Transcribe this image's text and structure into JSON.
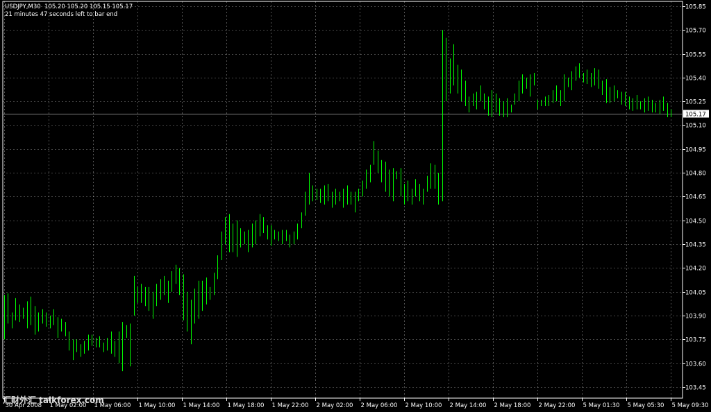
{
  "header": {
    "symbol_line": "USDJPY,M30  105.20 105.20 105.15 105.17",
    "countdown": "21 minutes 47 seconds left to bar end"
  },
  "watermark": "汇财外汇 talkforex.com",
  "chart_data": {
    "type": "ohlc",
    "symbol": "USDJPY",
    "timeframe": "M30",
    "current_price": 105.17,
    "current_price_label": "105.17",
    "ylim": [
      103.38,
      105.88
    ],
    "yticks": [
      105.85,
      105.7,
      105.55,
      105.4,
      105.25,
      105.1,
      104.95,
      104.8,
      104.65,
      104.5,
      104.35,
      104.2,
      104.05,
      103.9,
      103.75,
      103.6,
      103.45
    ],
    "ytick_labels": [
      "105.85",
      "105.70",
      "105.55",
      "105.40",
      "105.25",
      "105.10",
      "104.95",
      "104.80",
      "104.65",
      "104.50",
      "104.35",
      "104.20",
      "104.05",
      "103.90",
      "103.75",
      "103.60",
      "103.45"
    ],
    "xtick_labels": [
      "30 Apr 2008",
      "1 May 02:00",
      "1 May 06:00",
      "1 May 10:00",
      "1 May 14:00",
      "1 May 18:00",
      "1 May 22:00",
      "2 May 02:00",
      "2 May 06:00",
      "2 May 10:00",
      "2 May 14:00",
      "2 May 18:00",
      "2 May 22:00",
      "5 May 01:30",
      "5 May 05:30",
      "5 May 09:30"
    ],
    "grid": true,
    "bar_color": "#00ff00",
    "background": "#000000",
    "grid_color": "#ffffff",
    "bars": [
      [
        103.75,
        104.03
      ],
      [
        103.85,
        104.04
      ],
      [
        103.82,
        103.92
      ],
      [
        103.87,
        104.01
      ],
      [
        103.86,
        103.97
      ],
      [
        103.88,
        103.95
      ],
      [
        103.82,
        103.99
      ],
      [
        103.84,
        104.02
      ],
      [
        103.78,
        103.96
      ],
      [
        103.8,
        103.92
      ],
      [
        103.85,
        103.94
      ],
      [
        103.83,
        103.92
      ],
      [
        103.82,
        103.9
      ],
      [
        103.84,
        103.94
      ],
      [
        103.76,
        103.89
      ],
      [
        103.8,
        103.88
      ],
      [
        103.77,
        103.86
      ],
      [
        103.68,
        103.8
      ],
      [
        103.62,
        103.75
      ],
      [
        103.67,
        103.75
      ],
      [
        103.64,
        103.72
      ],
      [
        103.66,
        103.74
      ],
      [
        103.68,
        103.78
      ],
      [
        103.71,
        103.78
      ],
      [
        103.7,
        103.76
      ],
      [
        103.7,
        103.77
      ],
      [
        103.67,
        103.73
      ],
      [
        103.68,
        103.76
      ],
      [
        103.66,
        103.8
      ],
      [
        103.64,
        103.74
      ],
      [
        103.6,
        103.8
      ],
      [
        103.55,
        103.86
      ],
      [
        103.76,
        103.84
      ],
      [
        103.58,
        103.85
      ],
      [
        103.9,
        104.15
      ],
      [
        103.98,
        104.08
      ],
      [
        103.98,
        104.1
      ],
      [
        103.96,
        104.08
      ],
      [
        103.93,
        104.08
      ],
      [
        103.88,
        104.05
      ],
      [
        103.96,
        104.1
      ],
      [
        104.0,
        104.13
      ],
      [
        104.03,
        104.15
      ],
      [
        103.98,
        104.12
      ],
      [
        104.05,
        104.18
      ],
      [
        104.1,
        104.22
      ],
      [
        104.03,
        104.2
      ],
      [
        103.87,
        104.16
      ],
      [
        103.8,
        104.05
      ],
      [
        103.72,
        104.0
      ],
      [
        103.85,
        104.07
      ],
      [
        103.88,
        104.12
      ],
      [
        103.93,
        104.12
      ],
      [
        103.97,
        104.14
      ],
      [
        104.0,
        104.08
      ],
      [
        104.03,
        104.17
      ],
      [
        104.13,
        104.28
      ],
      [
        104.25,
        104.43
      ],
      [
        104.35,
        104.52
      ],
      [
        104.3,
        104.54
      ],
      [
        104.3,
        104.48
      ],
      [
        104.27,
        104.5
      ],
      [
        104.33,
        104.45
      ],
      [
        104.35,
        104.43
      ],
      [
        104.3,
        104.44
      ],
      [
        104.33,
        104.48
      ],
      [
        104.35,
        104.5
      ],
      [
        104.4,
        104.54
      ],
      [
        104.42,
        104.52
      ],
      [
        104.38,
        104.47
      ],
      [
        104.34,
        104.47
      ],
      [
        104.38,
        104.44
      ],
      [
        104.37,
        104.43
      ],
      [
        104.35,
        104.44
      ],
      [
        104.37,
        104.44
      ],
      [
        104.33,
        104.41
      ],
      [
        104.35,
        104.43
      ],
      [
        104.38,
        104.48
      ],
      [
        104.45,
        104.55
      ],
      [
        104.53,
        104.68
      ],
      [
        104.6,
        104.8
      ],
      [
        104.62,
        104.72
      ],
      [
        104.63,
        104.7
      ],
      [
        104.61,
        104.7
      ],
      [
        104.6,
        104.72
      ],
      [
        104.62,
        104.73
      ],
      [
        104.58,
        104.68
      ],
      [
        104.6,
        104.7
      ],
      [
        104.62,
        104.68
      ],
      [
        104.58,
        104.7
      ],
      [
        104.6,
        104.72
      ],
      [
        104.6,
        104.68
      ],
      [
        104.55,
        104.68
      ],
      [
        104.62,
        104.7
      ],
      [
        104.65,
        104.75
      ],
      [
        104.7,
        104.82
      ],
      [
        104.74,
        104.85
      ],
      [
        104.85,
        105.0
      ],
      [
        104.8,
        104.94
      ],
      [
        104.74,
        104.88
      ],
      [
        104.68,
        104.87
      ],
      [
        104.65,
        104.82
      ],
      [
        104.62,
        104.83
      ],
      [
        104.76,
        104.81
      ],
      [
        104.65,
        104.83
      ],
      [
        104.6,
        104.73
      ],
      [
        104.62,
        104.75
      ],
      [
        104.6,
        104.7
      ],
      [
        104.65,
        104.76
      ],
      [
        104.62,
        104.73
      ],
      [
        104.6,
        104.7
      ],
      [
        104.68,
        104.78
      ],
      [
        104.7,
        104.86
      ],
      [
        104.7,
        104.85
      ],
      [
        104.6,
        104.8
      ],
      [
        104.62,
        105.7
      ],
      [
        105.25,
        105.65
      ],
      [
        105.3,
        105.52
      ],
      [
        105.35,
        105.61
      ],
      [
        105.3,
        105.48
      ],
      [
        105.25,
        105.45
      ],
      [
        105.22,
        105.38
      ],
      [
        105.18,
        105.28
      ],
      [
        105.22,
        105.3
      ],
      [
        105.2,
        105.31
      ],
      [
        105.25,
        105.35
      ],
      [
        105.2,
        105.3
      ],
      [
        105.16,
        105.28
      ],
      [
        105.15,
        105.32
      ],
      [
        105.18,
        105.3
      ],
      [
        105.16,
        105.27
      ],
      [
        105.15,
        105.25
      ],
      [
        105.15,
        105.27
      ],
      [
        105.18,
        105.23
      ],
      [
        105.23,
        105.3
      ],
      [
        105.25,
        105.38
      ],
      [
        105.3,
        105.42
      ],
      [
        105.33,
        105.4
      ],
      [
        105.28,
        105.42
      ],
      [
        105.35,
        105.43
      ],
      [
        105.2,
        105.26
      ],
      [
        105.22,
        105.26
      ],
      [
        105.22,
        105.28
      ],
      [
        105.22,
        105.29
      ],
      [
        105.24,
        105.32
      ],
      [
        105.25,
        105.35
      ],
      [
        105.22,
        105.32
      ],
      [
        105.25,
        105.42
      ],
      [
        105.34,
        105.4
      ],
      [
        105.32,
        105.44
      ],
      [
        105.38,
        105.47
      ],
      [
        105.4,
        105.49
      ],
      [
        105.37,
        105.43
      ],
      [
        105.36,
        105.45
      ],
      [
        105.34,
        105.43
      ],
      [
        105.35,
        105.46
      ],
      [
        105.33,
        105.45
      ],
      [
        105.29,
        105.38
      ],
      [
        105.24,
        105.39
      ],
      [
        105.24,
        105.34
      ],
      [
        105.25,
        105.35
      ],
      [
        105.27,
        105.32
      ],
      [
        105.23,
        105.31
      ],
      [
        105.22,
        105.31
      ],
      [
        105.2,
        105.28
      ],
      [
        105.19,
        105.27
      ],
      [
        105.2,
        105.29
      ],
      [
        105.2,
        105.25
      ],
      [
        105.18,
        105.27
      ],
      [
        105.19,
        105.28
      ],
      [
        105.18,
        105.26
      ],
      [
        105.18,
        105.24
      ],
      [
        105.17,
        105.26
      ],
      [
        105.19,
        105.28
      ],
      [
        105.15,
        105.24
      ],
      [
        105.15,
        105.2
      ]
    ]
  }
}
